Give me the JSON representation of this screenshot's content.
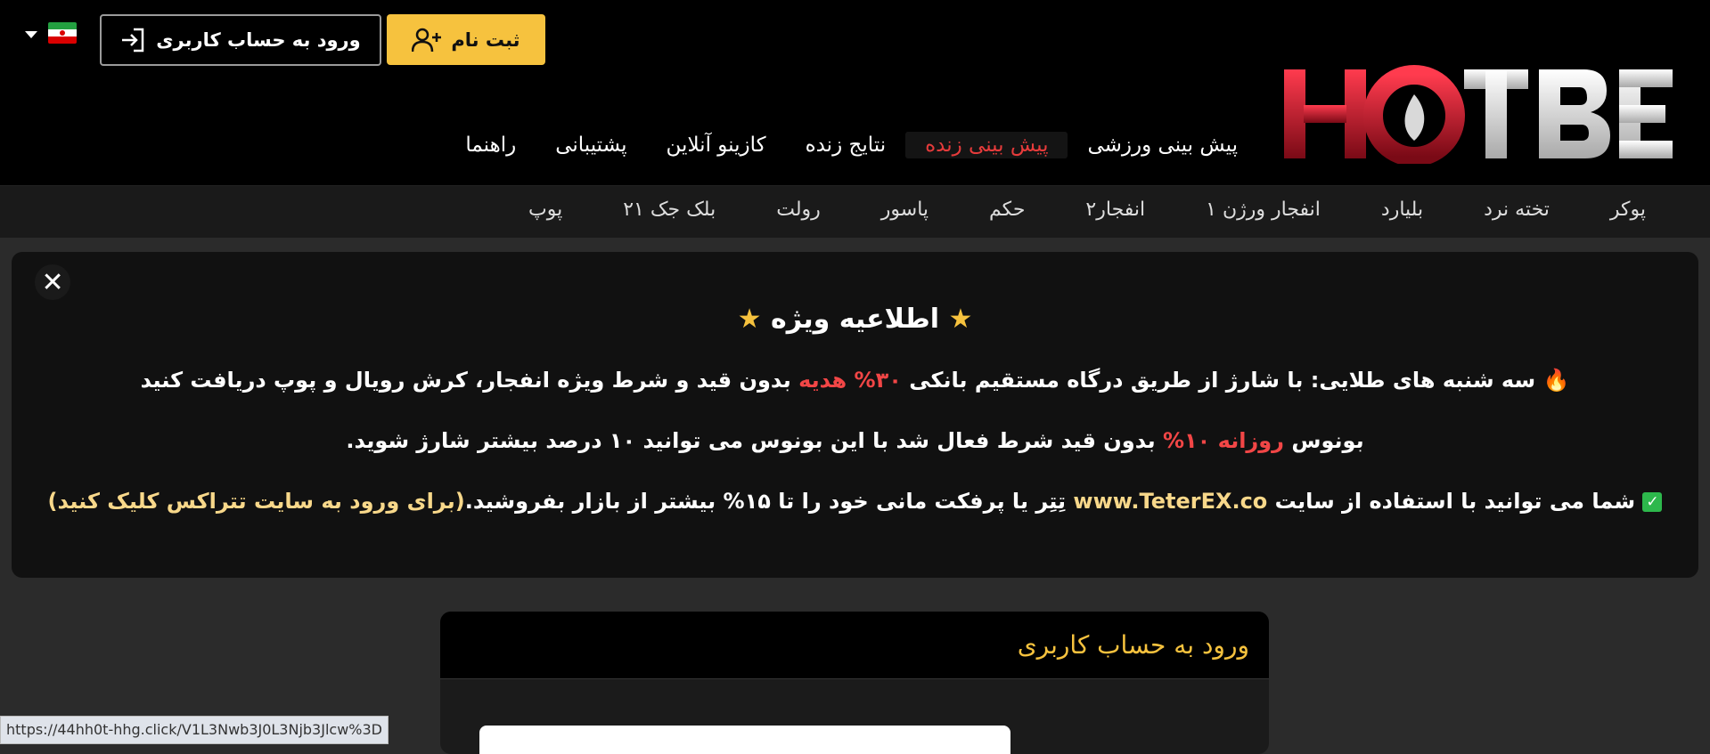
{
  "header": {
    "logo_text": "HOTBET",
    "register_label": "ثبت نام",
    "login_label": "ورود به حساب کاربری",
    "language_flag": "iran-flag-icon",
    "main_nav": [
      {
        "label": "پیش بینی ورزشی"
      },
      {
        "label": "پیش بینی زنده"
      },
      {
        "label": "نتایج زنده"
      },
      {
        "label": "کازینو آنلاین"
      },
      {
        "label": "پشتیبانی"
      },
      {
        "label": "راهنما"
      }
    ]
  },
  "subnav": [
    {
      "label": "پوکر"
    },
    {
      "label": "تخته نرد"
    },
    {
      "label": "بلیارد"
    },
    {
      "label": "انفجار ورژن ۱"
    },
    {
      "label": "انفجار۲"
    },
    {
      "label": "حکم"
    },
    {
      "label": "پاسور"
    },
    {
      "label": "رولت"
    },
    {
      "label": "بلک جک ۲۱"
    },
    {
      "label": "پوپ"
    }
  ],
  "notice": {
    "title": "اطلاعیه ویژه",
    "line1_pre": "سه شنبه های طلایی: با شارژ از طریق درگاه مستقیم بانکی",
    "line1_highlight": "۳۰% هدیه",
    "line1_post": "بدون قید و شرط ویژه انفجار، کرش رویال و پوپ دریافت کنید",
    "line2_pre": "بونوس",
    "line2_highlight": "روزانه ۱۰%",
    "line2_post": "بدون قید شرط فعال شد با این بونوس می توانید ۱۰ درصد بیشتر شارژ شوید.",
    "line3_pre": "شما می توانید با استفاده از سایت",
    "line3_site": "www.TeterEX.co",
    "line3_mid": "تِتِر یا پرفکت مانی خود را تا ۱۵% بیشتر از بازار بفروشید.",
    "line3_link": "(برای ورود به سایت تتراکس کلیک کنید)"
  },
  "login_card": {
    "title": "ورود به حساب کاربری"
  },
  "status_url": "https://44hh0t-hhg.click/V1L3Nwb3J0L3Njb3Jlcw%3D",
  "colors": {
    "accent": "#f6c23e",
    "live": "#e63b3b",
    "logo_red": "#c0152a"
  }
}
